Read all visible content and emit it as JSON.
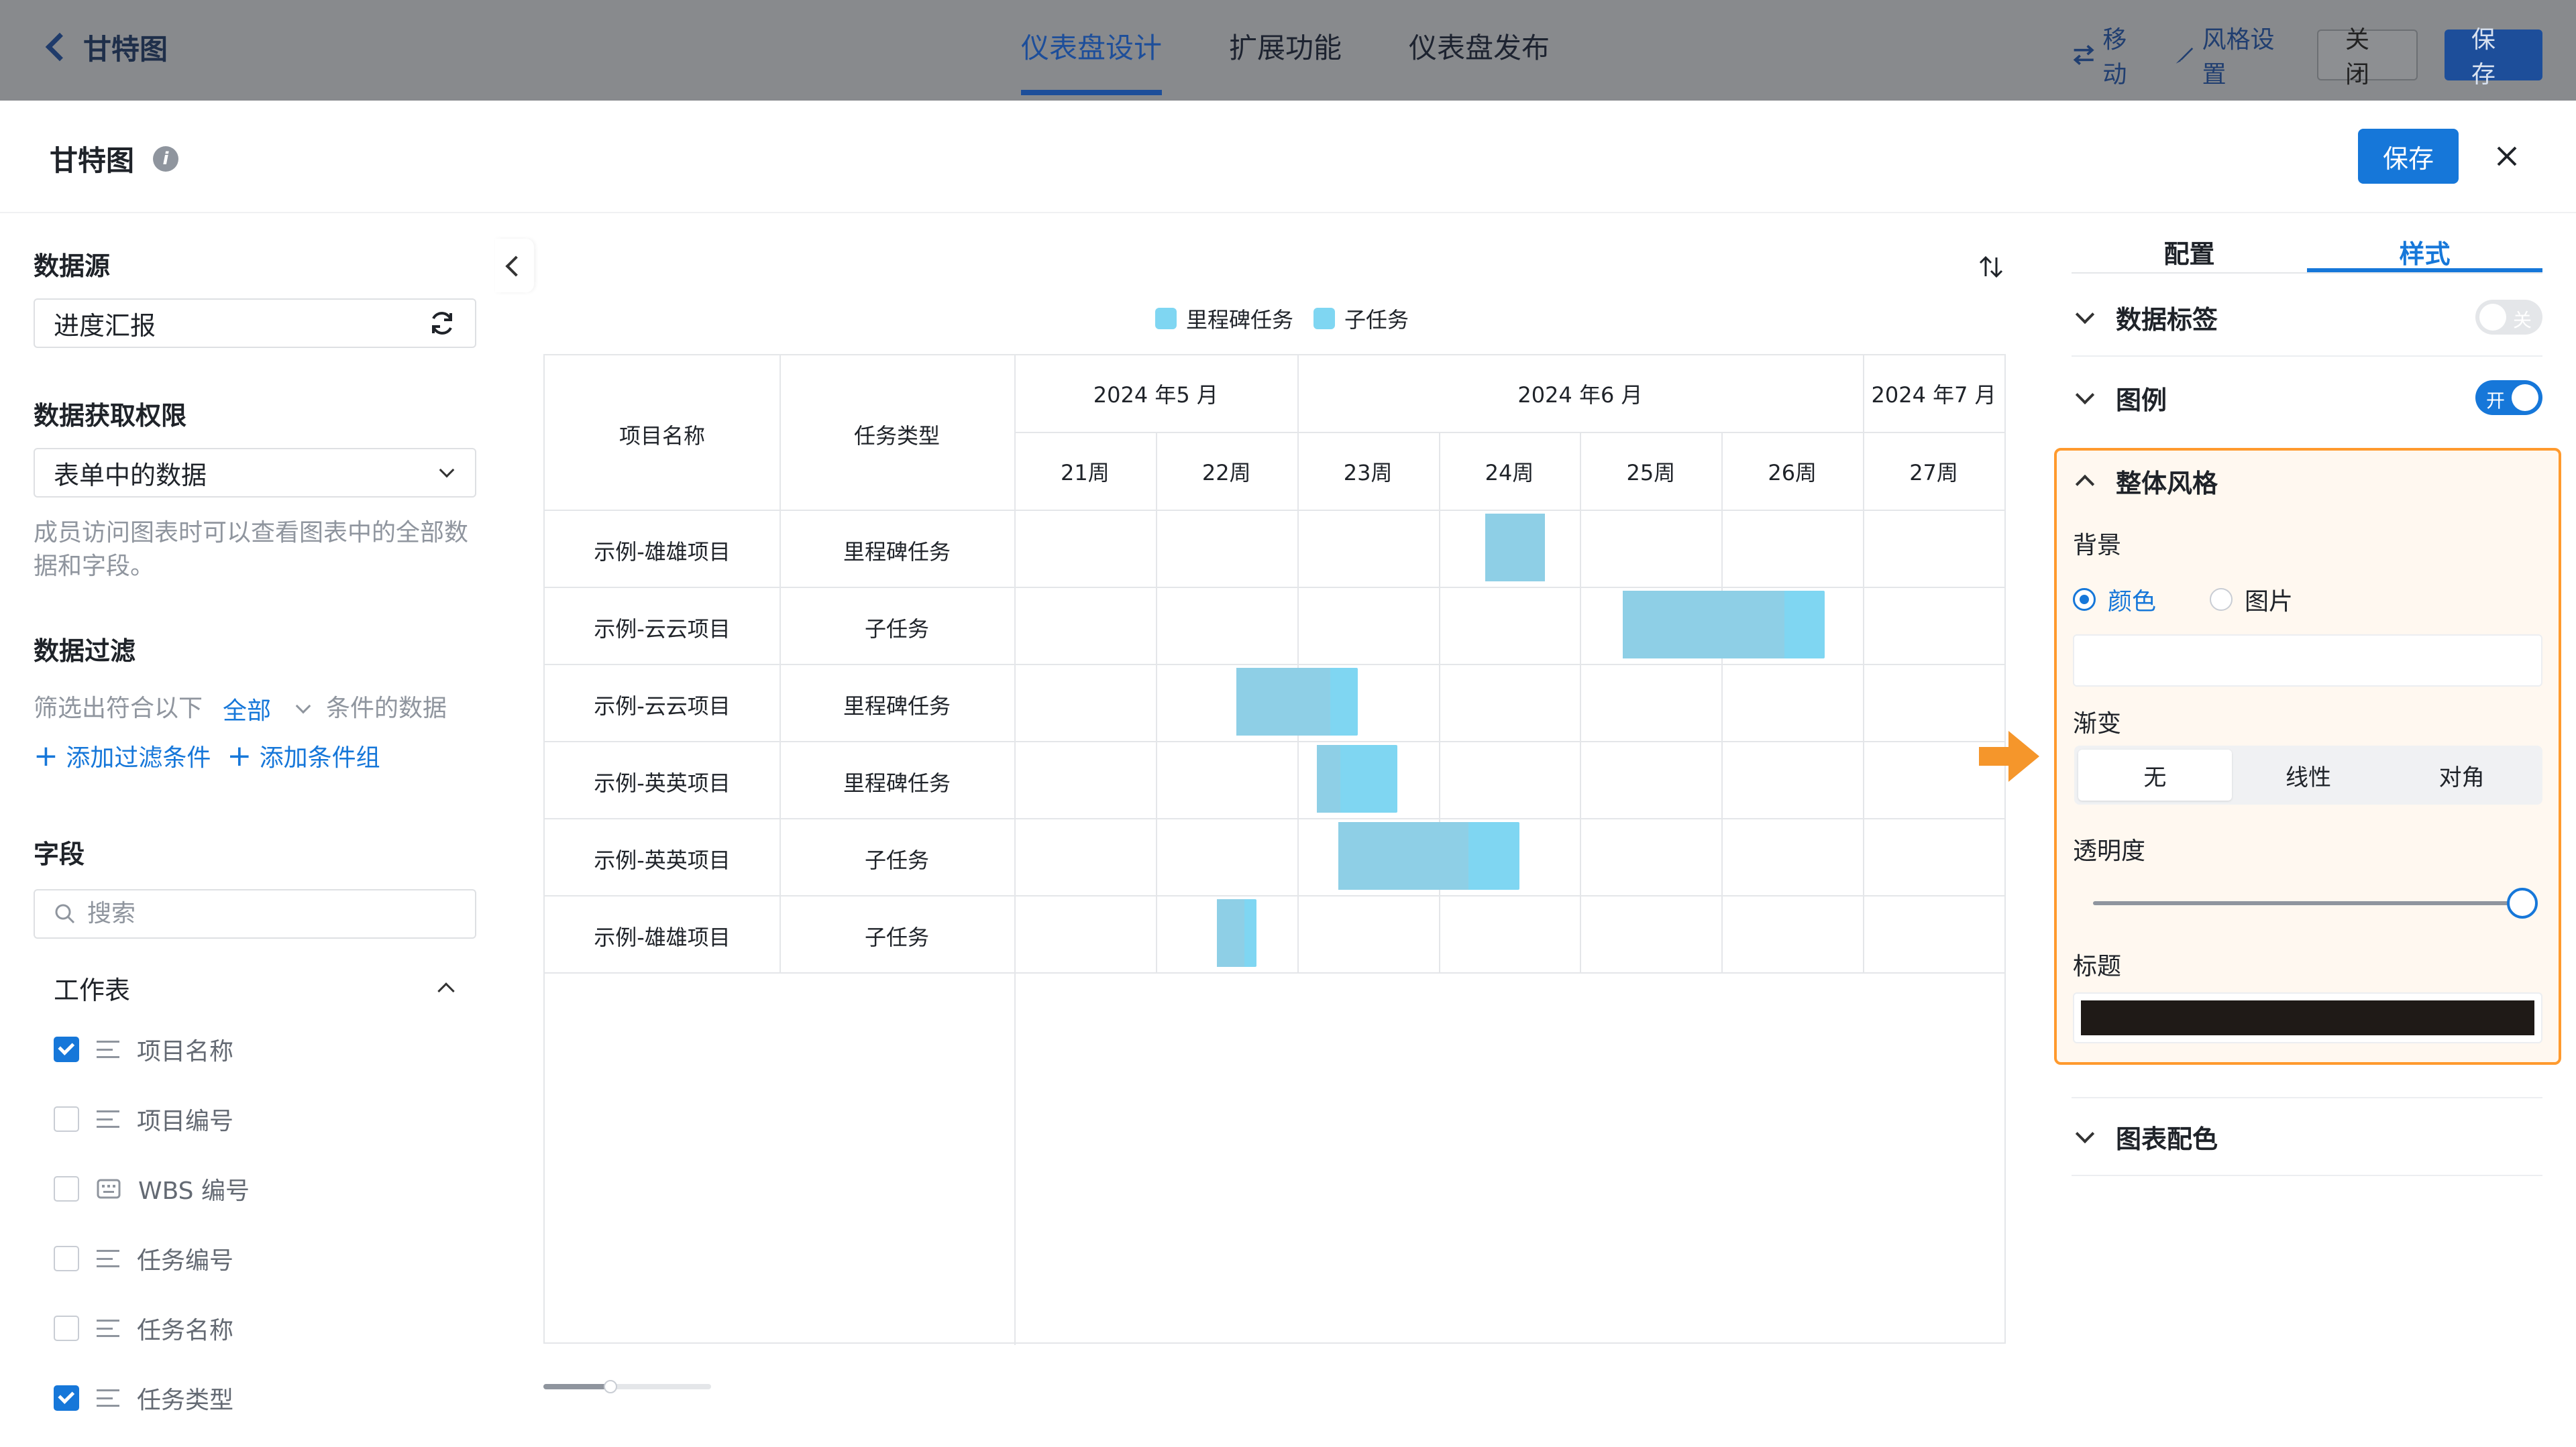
{
  "topbar": {
    "back_title": "甘特图",
    "tabs": [
      "仪表盘设计",
      "扩展功能",
      "仪表盘发布"
    ],
    "move": "移动",
    "style_settings": "风格设置",
    "close": "关闭",
    "save": "保存"
  },
  "modal": {
    "title": "甘特图",
    "save": "保存"
  },
  "left": {
    "datasource_title": "数据源",
    "datasource_value": "进度汇报",
    "perm_title": "数据获取权限",
    "perm_value": "表单中的数据",
    "perm_desc": "成员访问图表时可以查看图表中的全部数据和字段。",
    "filter_title": "数据过滤",
    "filter_prefix": "筛选出符合以下",
    "filter_mode": "全部",
    "filter_suffix": "条件的数据",
    "add_filter": "添加过滤条件",
    "add_group": "添加条件组",
    "fields_title": "字段",
    "search_placeholder": "搜索",
    "worksheet_label": "工作表",
    "fields": [
      {
        "name": "项目名称",
        "checked": true,
        "icon": "text-lines-icon"
      },
      {
        "name": "项目编号",
        "checked": false,
        "icon": "text-lines-icon"
      },
      {
        "name": "WBS 编号",
        "checked": false,
        "icon": "keyboard-icon"
      },
      {
        "name": "任务编号",
        "checked": false,
        "icon": "text-lines-icon"
      },
      {
        "name": "任务名称",
        "checked": false,
        "icon": "text-lines-icon"
      },
      {
        "name": "任务类型",
        "checked": true,
        "icon": "text-lines-icon"
      }
    ]
  },
  "chart_data": {
    "type": "gantt",
    "legend": [
      {
        "name": "里程碑任务",
        "color": "#7fd6f2"
      },
      {
        "name": "子任务",
        "color": "#7fd6f2"
      }
    ],
    "columns": [
      "项目名称",
      "任务类型"
    ],
    "months": [
      {
        "label": "2024 年5 月",
        "weeks": 2
      },
      {
        "label": "2024 年6 月",
        "weeks": 4
      },
      {
        "label": "2024 年7 月",
        "weeks": 1
      }
    ],
    "weeks": [
      "21周",
      "22周",
      "23周",
      "24周",
      "25周",
      "26周",
      "27周"
    ],
    "rows": [
      {
        "project": "示例-雄雄项目",
        "type": "里程碑任务",
        "start": 3.33,
        "end": 3.75,
        "progress": 1.0
      },
      {
        "project": "示例-云云项目",
        "type": "子任务",
        "start": 4.3,
        "end": 5.73,
        "progress": 0.8
      },
      {
        "project": "示例-云云项目",
        "type": "里程碑任务",
        "start": 1.57,
        "end": 2.43,
        "progress": 0.77
      },
      {
        "project": "示例-英英项目",
        "type": "里程碑任务",
        "start": 2.14,
        "end": 2.71,
        "progress": 0.29
      },
      {
        "project": "示例-英英项目",
        "type": "子任务",
        "start": 2.29,
        "end": 3.57,
        "progress": 0.72
      },
      {
        "project": "示例-雄雄项目",
        "type": "子任务",
        "start": 1.43,
        "end": 1.71,
        "progress": 0.7
      }
    ],
    "bar_color": "#7fd6f2",
    "progress_color": "#8ecfe6"
  },
  "right": {
    "tabs": [
      "配置",
      "样式"
    ],
    "data_label": "数据标签",
    "data_label_toggle": "关",
    "legend": "图例",
    "legend_toggle": "开",
    "overall_style": "整体风格",
    "background": "背景",
    "bg_color": "颜色",
    "bg_image": "图片",
    "gradient": "渐变",
    "gradient_options": [
      "无",
      "线性",
      "对角"
    ],
    "opacity": "透明度",
    "opacity_value": 1.0,
    "title_label": "标题",
    "title_color": "#1f1a17",
    "chart_colors": "图表配色",
    "accent": "#1677d9",
    "highlight": "#ff9a2e"
  }
}
